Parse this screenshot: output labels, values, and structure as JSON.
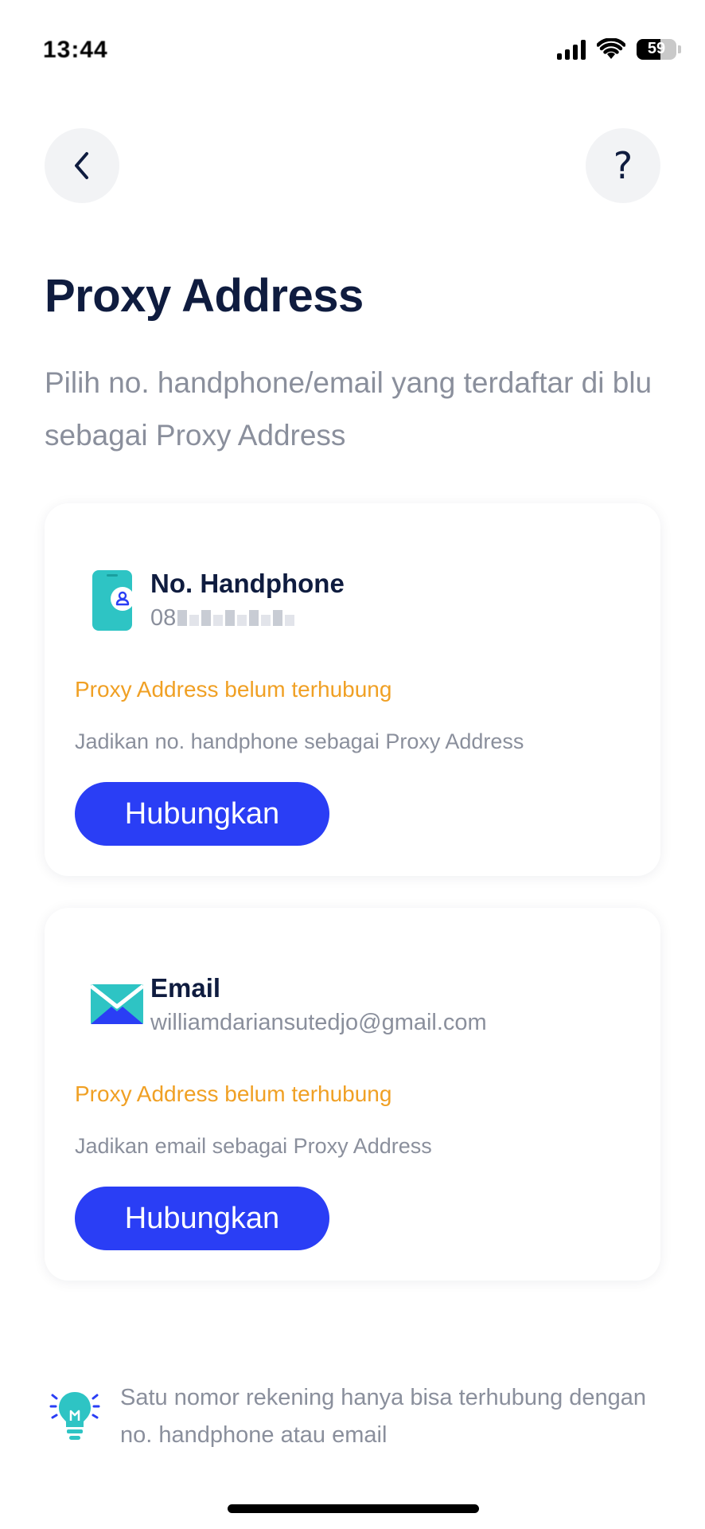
{
  "status_bar": {
    "time": "13:44",
    "battery_level": 59,
    "battery_label": "59",
    "icons": [
      "cellular-signal-icon",
      "wifi-icon",
      "battery-icon"
    ]
  },
  "header": {
    "back_icon": "chevron-left-icon",
    "help_label": "?"
  },
  "page": {
    "title": "Proxy Address",
    "subtitle": "Pilih no. handphone/email yang terdaftar di blu sebagai Proxy Address"
  },
  "cards": [
    {
      "icon": "phone-user-icon",
      "title": "No. Handphone",
      "value_prefix": "08",
      "value_masked": true,
      "status": "Proxy Address belum terhubung",
      "description": "Jadikan no. handphone sebagai Proxy Address",
      "button_label": "Hubungkan"
    },
    {
      "icon": "envelope-icon",
      "title": "Email",
      "value": "williamdariansutedjo@gmail.com",
      "status": "Proxy Address belum terhubung",
      "description": "Jadikan email sebagai Proxy Address",
      "button_label": "Hubungkan"
    }
  ],
  "info": {
    "icon": "lightbulb-icon",
    "text": "Satu nomor rekening hanya bisa terhubung dengan no. handphone atau email"
  },
  "colors": {
    "primary": "#2a3ef5",
    "warning": "#f0a024",
    "title": "#0f1c3f",
    "muted": "#8a8f9c",
    "teal": "#2ec4c4"
  }
}
